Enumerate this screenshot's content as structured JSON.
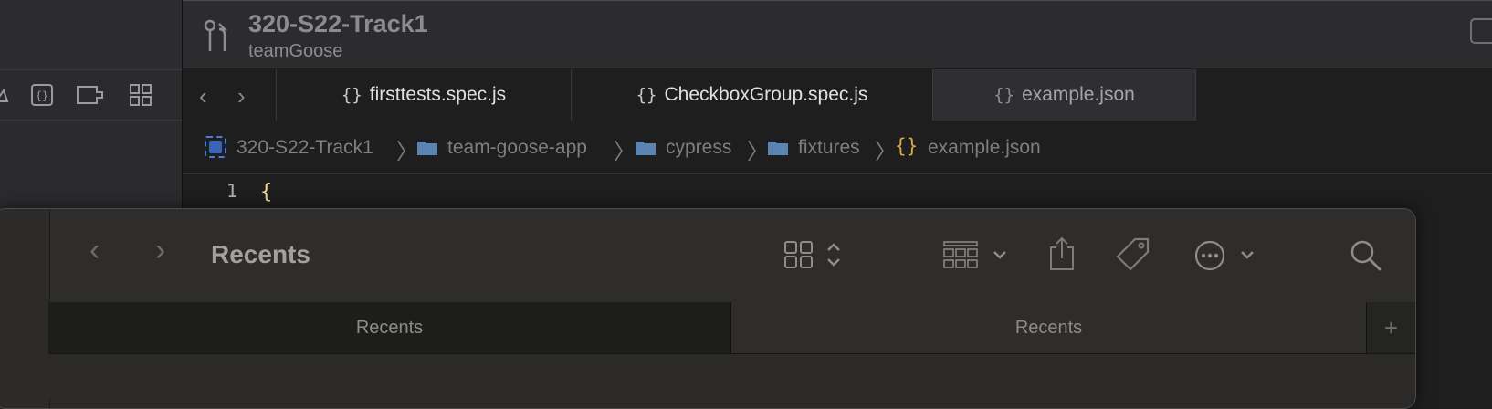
{
  "ide": {
    "project_title": "320-S22-Track1",
    "project_subtitle": "teamGoose",
    "tabs": [
      {
        "label": "firsttests.spec.js"
      },
      {
        "label": "CheckboxGroup.spec.js"
      },
      {
        "label": "example.json"
      }
    ],
    "tab_icon": "{}",
    "breadcrumb": [
      "320-S22-Track1",
      "team-goose-app",
      "cypress",
      "fixtures",
      "example.json"
    ],
    "editor": {
      "line_number": "1",
      "line_text": "{"
    },
    "colors": {
      "project_icon": "#3a64b8",
      "folder": "#5b84b3",
      "json_brace": "#d1a93d",
      "code_brace": "#f0d98a"
    }
  },
  "finder": {
    "title": "Recents",
    "tabs": [
      {
        "label": "Recents"
      },
      {
        "label": "Recents"
      }
    ],
    "add_tab_symbol": "+"
  }
}
